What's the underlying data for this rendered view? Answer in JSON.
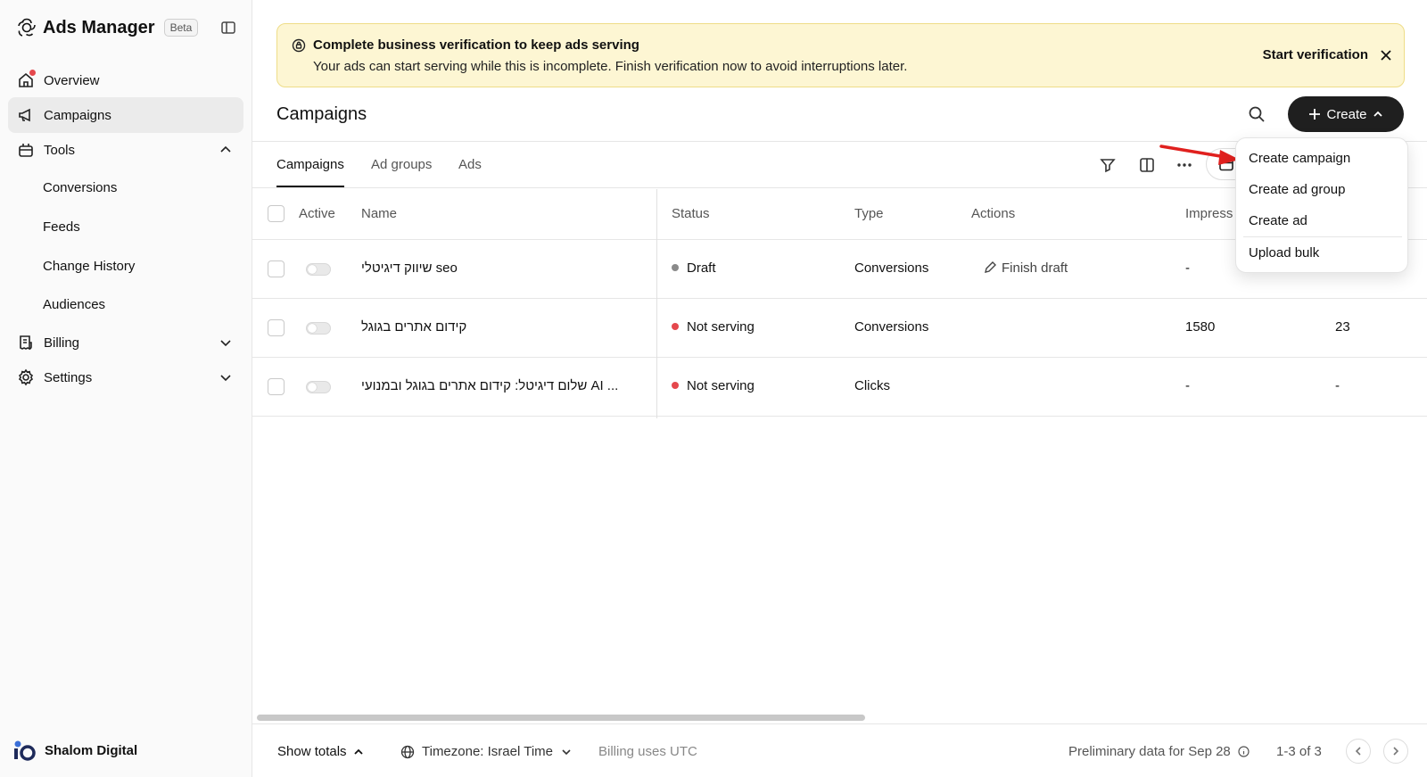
{
  "app": {
    "title": "Ads Manager",
    "badge": "Beta"
  },
  "sidebar": {
    "items": [
      {
        "label": "Overview"
      },
      {
        "label": "Campaigns"
      },
      {
        "label": "Tools"
      },
      {
        "label": "Billing"
      },
      {
        "label": "Settings"
      }
    ],
    "tools_sub": [
      "Conversions",
      "Feeds",
      "Change History",
      "Audiences"
    ],
    "account": "Shalom Digital"
  },
  "banner": {
    "title": "Complete business verification to keep ads serving",
    "text": "Your ads can start serving while this is incomplete. Finish verification now to avoid interruptions later.",
    "cta": "Start verification"
  },
  "page": {
    "title": "Campaigns",
    "create_label": "Create"
  },
  "tabs": [
    "Campaigns",
    "Ad groups",
    "Ads"
  ],
  "table": {
    "headers": {
      "active": "Active",
      "name": "Name",
      "status": "Status",
      "type": "Type",
      "actions": "Actions",
      "impressions": "Impress"
    },
    "rows": [
      {
        "name": "שיווק דיגיטלי seo",
        "status": "Draft",
        "status_color": "#8a8a8a",
        "type": "Conversions",
        "action": "Finish draft",
        "impressions": "-",
        "extra": ""
      },
      {
        "name": "קידום אתרים בגוגל",
        "status": "Not serving",
        "status_color": "#e5484d",
        "type": "Conversions",
        "action": "",
        "impressions": "1580",
        "extra": "23"
      },
      {
        "name": "שלום דיגיטל: קידום אתרים בגוגל ובמנועי AI ...",
        "status": "Not serving",
        "status_color": "#e5484d",
        "type": "Clicks",
        "action": "",
        "impressions": "-",
        "extra": "-"
      }
    ]
  },
  "dropdown": {
    "items": [
      "Create campaign",
      "Create ad group",
      "Create ad",
      "Upload bulk"
    ]
  },
  "footer": {
    "show_totals": "Show totals",
    "timezone": "Timezone: Israel Time",
    "billing": "Billing uses UTC",
    "preliminary": "Preliminary data for Sep 28",
    "range": "1-3 of 3"
  },
  "colors": {
    "accent_dark": "#1f1f1f",
    "banner_bg": "#fdf6d3",
    "error": "#e5484d"
  }
}
